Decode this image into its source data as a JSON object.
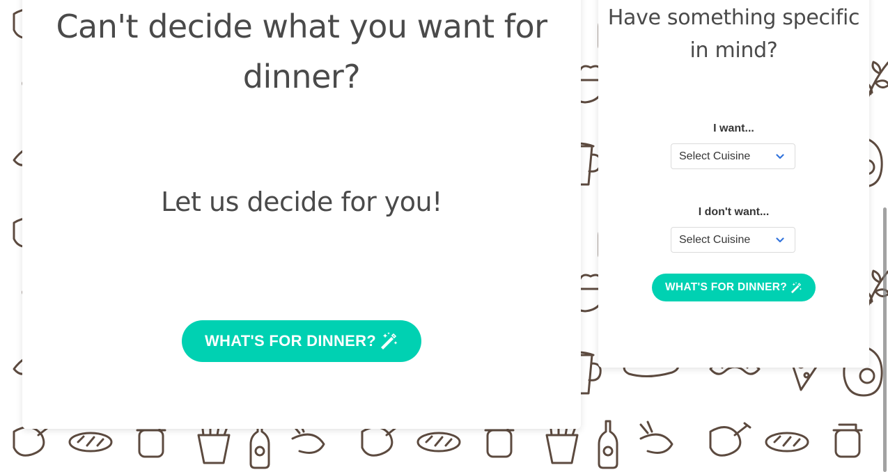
{
  "main_card": {
    "title": "Can't decide what you want for dinner?",
    "subtitle": "Let us decide for you!",
    "button_label": "WHAT'S FOR DINNER?"
  },
  "side_card": {
    "title": "Have something specific in mind?",
    "want_label": "I want...",
    "want_select_value": "Select Cuisine",
    "dont_want_label": "I don't want...",
    "dont_want_select_value": "Select Cuisine",
    "button_label": "WHAT'S FOR DINNER?"
  },
  "icons": {
    "button_icon": "magic-wand-icon",
    "select_icon": "chevron-down-icon",
    "background": "food-doodle-pattern"
  },
  "colors": {
    "accent": "#00d1b2",
    "heading_text": "#4a4a4a",
    "label_text": "#363636",
    "pattern_stroke": "#5c4a3f",
    "chevron": "#3273dc"
  }
}
